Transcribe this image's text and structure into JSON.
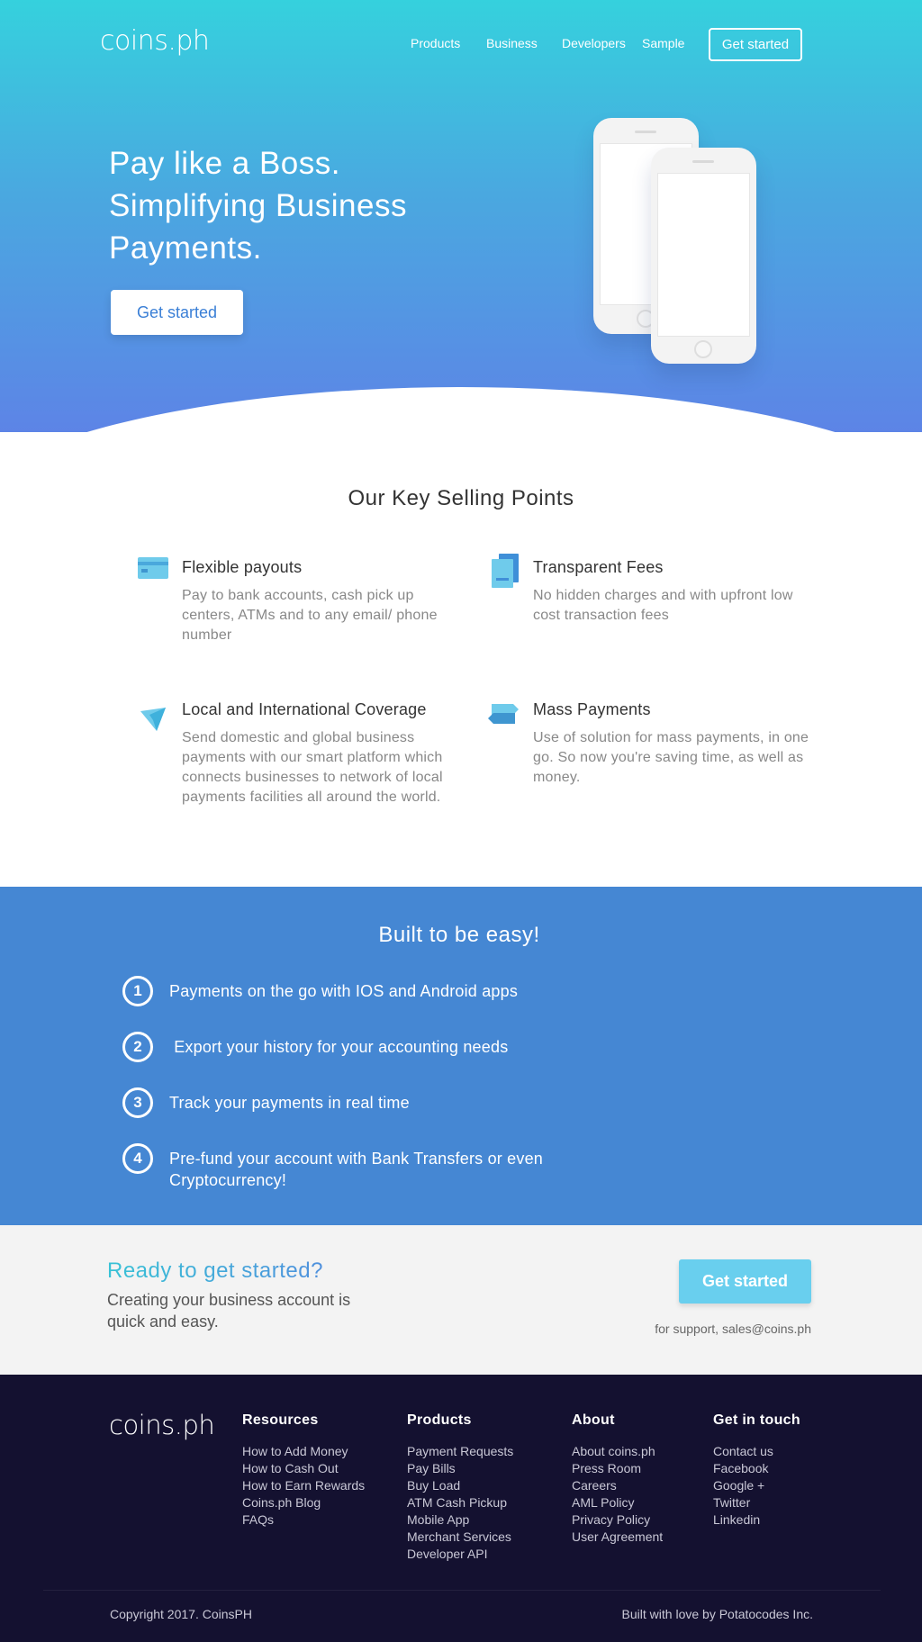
{
  "header": {
    "logo": "coins.ph",
    "nav": [
      "Products",
      "Business",
      "Developers",
      "Sample"
    ],
    "cta": "Get started"
  },
  "hero": {
    "headline_lines": [
      "Pay like a Boss.",
      "Simplifying Business",
      "Payments."
    ],
    "cta": "Get started"
  },
  "selling_points": {
    "title": "Our Key Selling Points",
    "items": [
      {
        "icon": "card-icon",
        "title": "Flexible payouts",
        "description": "Pay to bank accounts, cash pick up centers, ATMs and to any email/ phone number"
      },
      {
        "icon": "receipt-icon",
        "title": "Transparent Fees",
        "description": "No hidden charges and with upfront low cost transaction fees"
      },
      {
        "icon": "paper-plane-icon",
        "title": "Local and International Coverage",
        "description": "Send domestic and global business payments with our smart platform which connects businesses to network of local payments facilities all around the world."
      },
      {
        "icon": "transfer-arrows-icon",
        "title": "Mass Payments",
        "description": "Use of solution for mass payments, in one go. So now you're saving time, as well as money."
      }
    ]
  },
  "easy": {
    "title": "Built to be easy!",
    "steps": [
      {
        "num": "1",
        "text": "Payments on the go with IOS and Android apps"
      },
      {
        "num": "2",
        "text": " Export your history for your accounting needs"
      },
      {
        "num": "3",
        "text": "Track your payments in real time"
      },
      {
        "num": "4",
        "text": "Pre-fund your account with Bank Transfers or even Cryptocurrency!"
      }
    ]
  },
  "ready": {
    "title": "Ready to get started?",
    "subtitle": "Creating your business account is quick and easy.",
    "cta": "Get started",
    "support": "for support, sales@coins.ph"
  },
  "footer": {
    "logo": "coins.ph",
    "columns": [
      {
        "heading": "Resources",
        "links": [
          "How to Add Money",
          "How to Cash Out",
          "How to Earn Rewards",
          "Coins.ph Blog",
          "FAQs"
        ]
      },
      {
        "heading": "Products",
        "links": [
          "Payment Requests",
          "Pay Bills",
          "Buy Load",
          "ATM Cash Pickup",
          "Mobile App",
          "Merchant Services",
          "Developer API"
        ]
      },
      {
        "heading": "About",
        "links": [
          "About coins.ph",
          "Press Room",
          "Careers",
          "AML Policy",
          "Privacy Policy",
          "User Agreement"
        ]
      },
      {
        "heading": "Get in touch",
        "links": [
          "Contact us",
          "Facebook",
          "Google +",
          "Twitter",
          "Linkedin"
        ]
      }
    ],
    "copyright": "Copyright 2017. CoinsPH",
    "credits": "Built with love by Potatocodes Inc."
  },
  "colors": {
    "hero_top": "#35d1dd",
    "hero_bottom": "#5d84e6",
    "easy_bg": "#4587d3",
    "ready_bg": "#f3f3f3",
    "footer_bg": "#141130",
    "cta_light": "#69cfee"
  }
}
